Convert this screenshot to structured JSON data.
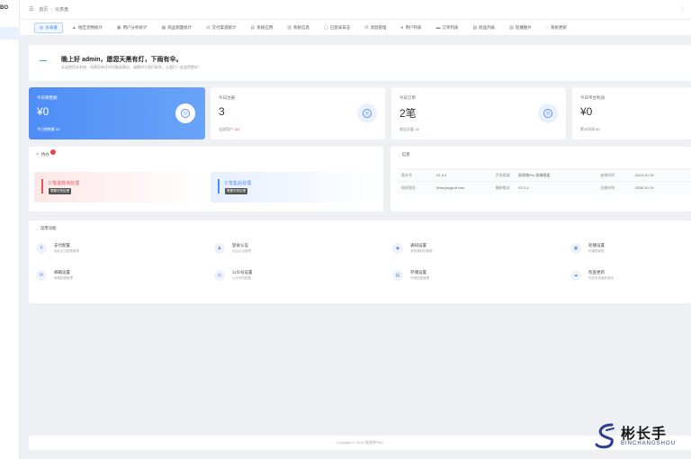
{
  "sidebar": {
    "logo": "BO"
  },
  "header": {
    "breadcrumb": [
      "首页",
      "仪表盘"
    ]
  },
  "tabs": [
    {
      "label": "仪表盘",
      "icon": "dashboard-icon"
    },
    {
      "label": "地区货物统计",
      "icon": "chart-icon"
    },
    {
      "label": "用户分析统计",
      "icon": "user-icon"
    },
    {
      "label": "商品销量统计",
      "icon": "goods-icon"
    },
    {
      "label": "交付渠道统计",
      "icon": "channel-icon"
    },
    {
      "label": "系统应用",
      "icon": "app-icon"
    },
    {
      "label": "系统信息",
      "icon": "info-icon"
    },
    {
      "label": "已登录日志",
      "icon": "log-icon"
    },
    {
      "label": "消息管理",
      "icon": "message-icon"
    },
    {
      "label": "用户列表",
      "icon": "users-icon"
    },
    {
      "label": "订单列表",
      "icon": "order-icon"
    },
    {
      "label": "商品列表",
      "icon": "product-icon"
    },
    {
      "label": "轮播图片",
      "icon": "image-icon"
    },
    {
      "label": "系统更新",
      "icon": "update-icon"
    }
  ],
  "welcome": {
    "greeting": "晚上好 admin，愿您天黑有灯，下雨有伞。",
    "subtitle": "欢迎使用本系统，如果您有任何问题或建议，请随时与我们联系，让我们一起变得更好！"
  },
  "stats": [
    {
      "label": "今日销售额",
      "value": "¥0",
      "foot_label": "今日销售额 ¥0",
      "foot_highlight": ""
    },
    {
      "label": "今日注册",
      "value": "3",
      "foot_label": "全部用户",
      "foot_highlight": "161"
    },
    {
      "label": "今日订单",
      "value": "2笔",
      "foot_label": "商品总量",
      "foot_highlight": "18"
    },
    {
      "label": "今日平台利润",
      "value": "¥0",
      "foot_label": "累计利润 ¥0",
      "foot_highlight": ""
    }
  ],
  "todo": {
    "title": "待办",
    "items": [
      {
        "title": "0 笔退款待处理",
        "tag": "需要尽快处理"
      },
      {
        "title": "0 笔售后处理",
        "tag": "需要尽快处理"
      }
    ]
  },
  "info": {
    "title": "信息",
    "rows": [
      [
        "版本号",
        "V2.3.4",
        "开发框架",
        "陇源商Pro 前端框架",
        "安装时间",
        "2023-10-19"
      ],
      [
        "授权域名",
        "Www.jingyuff.com",
        "最新版本",
        "V2.3.4",
        "注册时间",
        "2008-10-19"
      ]
    ]
  },
  "functions": {
    "title": "常用功能",
    "items": [
      {
        "name": "支付配置",
        "desc": "商品支付配置管理",
        "icon": "payment-icon"
      },
      {
        "name": "登录认证",
        "desc": "后台认证管理",
        "icon": "login-icon"
      },
      {
        "name": "通知设置",
        "desc": "消息通知的管理",
        "icon": "notify-icon"
      },
      {
        "name": "轮播设置",
        "desc": "轮播图管理",
        "icon": "carousel-icon"
      },
      {
        "name": "邮箱设置",
        "desc": "邮箱配置管理",
        "icon": "mail-icon"
      },
      {
        "name": "公众号设置",
        "desc": "公众号的配置",
        "icon": "wechat-icon"
      },
      {
        "name": "存储设置",
        "desc": "存储配置管理",
        "icon": "storage-icon"
      },
      {
        "name": "检查更新",
        "desc": "检查系统最新版本",
        "icon": "update-icon"
      }
    ]
  },
  "footer": {
    "copyright": "Copyright © 2024 陇源商PRO"
  },
  "watermark": {
    "title": "彬长手",
    "subtitle": "BINCHANGSHOU"
  },
  "colors": {
    "accent": "#2f7cf6",
    "danger": "#e55555",
    "background": "#eef0f4"
  }
}
